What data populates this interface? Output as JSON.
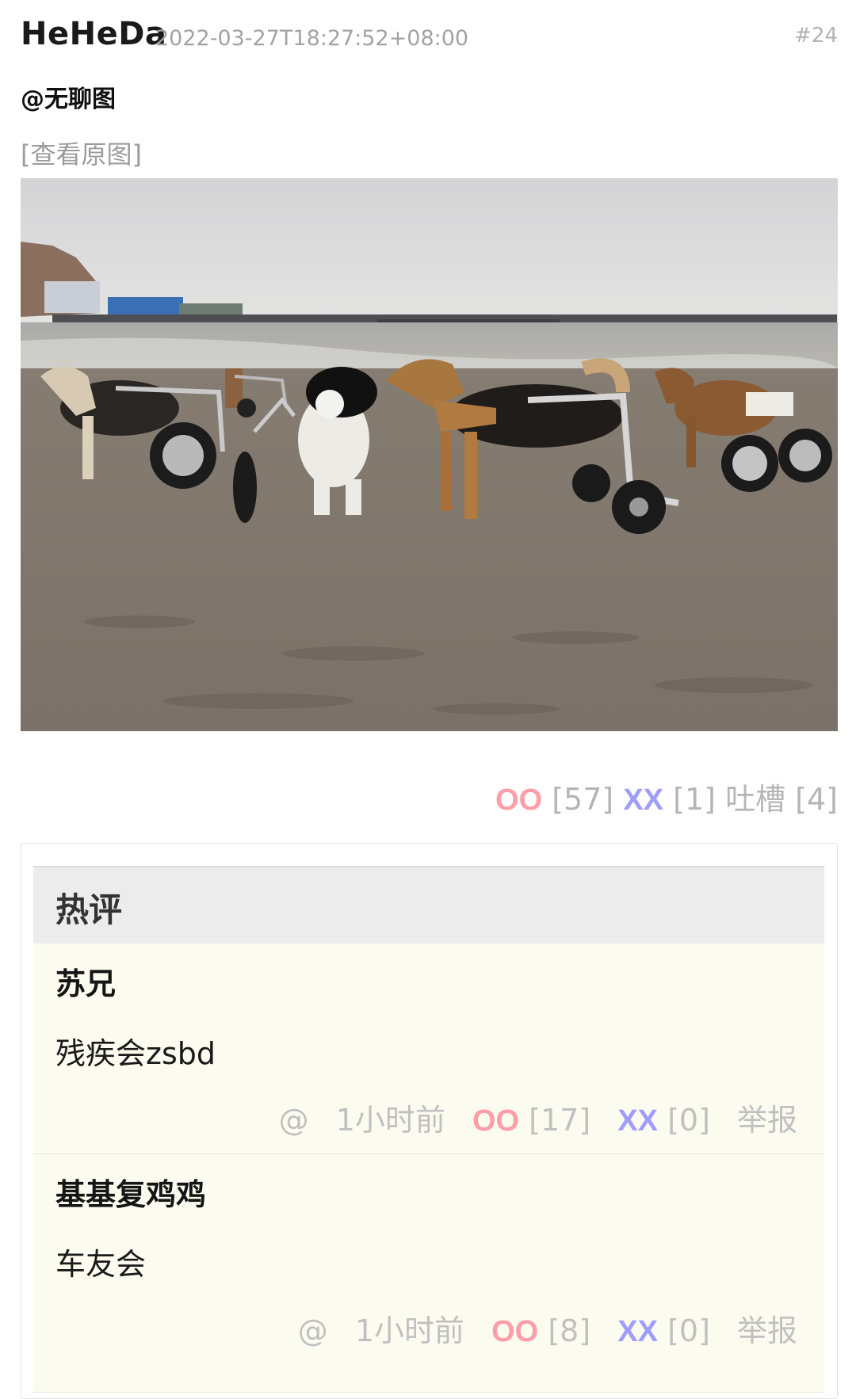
{
  "post": {
    "author": "HeHeDa",
    "timestamp": "2022-03-27T18:27:52+08:00",
    "number": "#24",
    "mention": "@无聊图",
    "view_original": "[查看原图]",
    "photo_alt": "dog-wheelchairs-beach-photo"
  },
  "votes": {
    "oo_label": "OO",
    "oo_count": "[57]",
    "xx_label": "XX",
    "xx_count": "[1]",
    "tucao_label": "吐槽",
    "tucao_count": "[4]"
  },
  "hot_comments": {
    "title": "热评",
    "items": [
      {
        "author": "苏兄",
        "text": "残疾会zsbd",
        "reply": "@",
        "time": "1小时前",
        "oo_label": "OO",
        "oo_count": "[17]",
        "xx_label": "XX",
        "xx_count": "[0]",
        "report": "举报"
      },
      {
        "author": "基基复鸡鸡",
        "text": "车友会",
        "reply": "@",
        "time": "1小时前",
        "oo_label": "OO",
        "oo_count": "[8]",
        "xx_label": "XX",
        "xx_count": "[0]",
        "report": "举报"
      }
    ]
  },
  "colors": {
    "oo": "#ff9da8",
    "xx": "#9f9dff",
    "muted": "#b5b5b5",
    "comment_bg": "#fbfcef",
    "header_bg": "#ececec"
  }
}
